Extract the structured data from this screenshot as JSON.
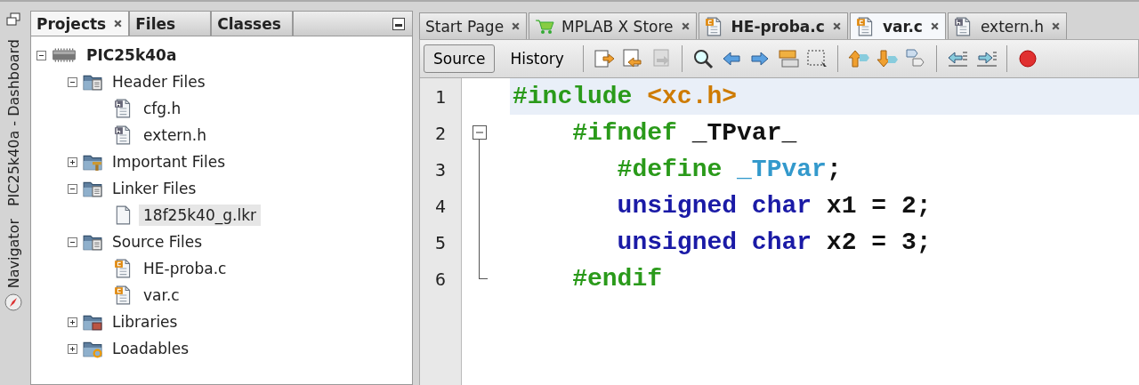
{
  "side_strip": [
    {
      "label": "PIC25k40a - Dashboard",
      "kind": "plain"
    },
    {
      "label": "Navigator",
      "kind": "compass"
    }
  ],
  "projects_panel": {
    "tabs": [
      {
        "label": "Projects",
        "selected": true,
        "closable": true
      },
      {
        "label": "Files",
        "selected": false,
        "closable": false
      },
      {
        "label": "Classes",
        "selected": false,
        "closable": false
      }
    ],
    "tree": [
      {
        "label": "PIC25k40a",
        "kind": "chip",
        "expanded": true,
        "selected": false,
        "children": [
          {
            "label": "Header Files",
            "kind": "folder-doc",
            "expanded": true,
            "selected": false,
            "children": [
              {
                "label": "cfg.h",
                "kind": "h-file",
                "selected": false
              },
              {
                "label": "extern.h",
                "kind": "h-file",
                "selected": false
              }
            ]
          },
          {
            "label": "Important Files",
            "kind": "folder-important",
            "expanded": false,
            "selected": false
          },
          {
            "label": "Linker Files",
            "kind": "folder-doc",
            "expanded": true,
            "selected": false,
            "children": [
              {
                "label": "18f25k40_g.lkr",
                "kind": "blank-file",
                "selected": true
              }
            ]
          },
          {
            "label": "Source Files",
            "kind": "folder-doc",
            "expanded": true,
            "selected": false,
            "children": [
              {
                "label": "HE-proba.c",
                "kind": "c-file",
                "selected": false
              },
              {
                "label": "var.c",
                "kind": "c-file",
                "selected": false
              }
            ]
          },
          {
            "label": "Libraries",
            "kind": "folder-lib",
            "expanded": false,
            "selected": false
          },
          {
            "label": "Loadables",
            "kind": "folder-load",
            "expanded": false,
            "selected": false
          }
        ]
      }
    ]
  },
  "editor": {
    "tabs": [
      {
        "label": "Start Page",
        "kind": "plain",
        "selected": false,
        "bold": false
      },
      {
        "label": "MPLAB X Store",
        "kind": "cart",
        "selected": false,
        "bold": false
      },
      {
        "label": "HE-proba.c",
        "kind": "c-file",
        "selected": false,
        "bold": true
      },
      {
        "label": "var.c",
        "kind": "c-file",
        "selected": true,
        "bold": true
      },
      {
        "label": "extern.h",
        "kind": "h-file",
        "selected": false,
        "bold": false
      }
    ],
    "view_buttons": [
      {
        "label": "Source",
        "selected": true
      },
      {
        "label": "History",
        "selected": false
      }
    ],
    "lines": [
      {
        "number": "1",
        "current": true,
        "kind": "plain",
        "tokens": [
          {
            "kind": "directive",
            "text": "#include"
          },
          {
            "kind": "header",
            "text": " <xc.h>"
          }
        ]
      },
      {
        "number": "2",
        "current": false,
        "kind": "fold-start",
        "tokens": [
          {
            "kind": "directive",
            "text": "    #ifndef"
          },
          {
            "kind": "ident",
            "text": " _TPvar_"
          }
        ]
      },
      {
        "number": "3",
        "current": false,
        "kind": "fold-body",
        "tokens": [
          {
            "kind": "directive",
            "text": "       #define"
          },
          {
            "kind": "macro",
            "text": " _TPvar"
          },
          {
            "kind": "plain",
            "text": ";"
          }
        ]
      },
      {
        "number": "4",
        "current": false,
        "kind": "fold-body",
        "tokens": [
          {
            "kind": "keyword",
            "text": "       unsigned char"
          },
          {
            "kind": "ident",
            "text": " x1 = 2;"
          }
        ]
      },
      {
        "number": "5",
        "current": false,
        "kind": "fold-body",
        "tokens": [
          {
            "kind": "keyword",
            "text": "       unsigned char"
          },
          {
            "kind": "ident",
            "text": " x2 = 3;"
          }
        ]
      },
      {
        "number": "6",
        "current": false,
        "kind": "fold-end",
        "tokens": [
          {
            "kind": "directive",
            "text": "    #endif"
          }
        ]
      }
    ]
  }
}
